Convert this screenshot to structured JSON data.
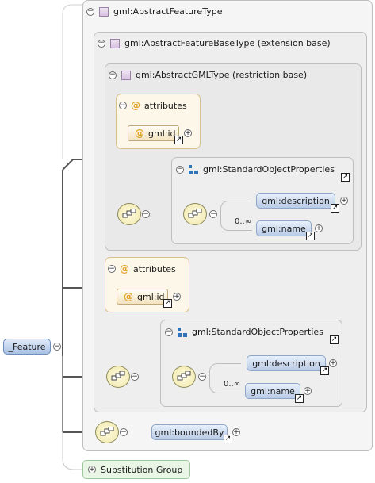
{
  "root": {
    "label": "_Feature"
  },
  "feature_type": {
    "title": "gml:AbstractFeatureType"
  },
  "base_type": {
    "title": "gml:AbstractFeatureBaseType (extension base)"
  },
  "gml_type": {
    "title": "gml:AbstractGMLType (restriction base)"
  },
  "attributes_inner": {
    "title": "attributes",
    "item": "gml:id"
  },
  "attributes_outer": {
    "title": "attributes",
    "item": "gml:id"
  },
  "sop_inner": {
    "title": "gml:StandardObjectProperties",
    "items": [
      "gml:description",
      "gml:name"
    ],
    "occurrence": "0..∞"
  },
  "sop_outer": {
    "title": "gml:StandardObjectProperties",
    "items": [
      "gml:description",
      "gml:name"
    ],
    "occurrence": "0..∞"
  },
  "bounded_by": {
    "label": "gml:boundedBy"
  },
  "substitution_group": {
    "label": "Substitution Group"
  },
  "symbols": {
    "collapse": "−",
    "expand": "+",
    "reference": "↗",
    "attribute": "@"
  }
}
